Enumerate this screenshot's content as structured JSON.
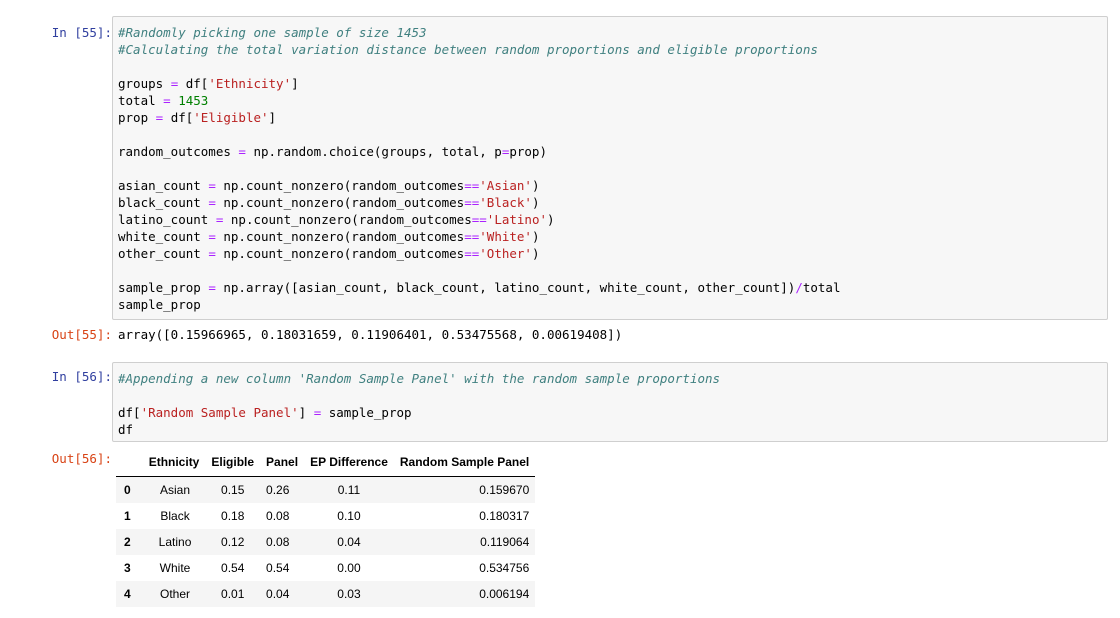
{
  "cell55": {
    "in_prompt": "In [55]:",
    "out_prompt": "Out[55]:",
    "output": "array([0.15966965, 0.18031659, 0.11906401, 0.53475568, 0.00619408])"
  },
  "cell56": {
    "in_prompt": "In [56]:",
    "out_prompt": "Out[56]:",
    "table": {
      "columns": [
        "Ethnicity",
        "Eligible",
        "Panel",
        "EP Difference",
        "Random Sample Panel"
      ],
      "rows": [
        {
          "index": "0",
          "ethnicity": "Asian",
          "eligible": "0.15",
          "panel": "0.26",
          "ep_difference": "0.11",
          "random_sample_panel": "0.159670"
        },
        {
          "index": "1",
          "ethnicity": "Black",
          "eligible": "0.18",
          "panel": "0.08",
          "ep_difference": "0.10",
          "random_sample_panel": "0.180317"
        },
        {
          "index": "2",
          "ethnicity": "Latino",
          "eligible": "0.12",
          "panel": "0.08",
          "ep_difference": "0.04",
          "random_sample_panel": "0.119064"
        },
        {
          "index": "3",
          "ethnicity": "White",
          "eligible": "0.54",
          "panel": "0.54",
          "ep_difference": "0.00",
          "random_sample_panel": "0.534756"
        },
        {
          "index": "4",
          "ethnicity": "Other",
          "eligible": "0.01",
          "panel": "0.04",
          "ep_difference": "0.03",
          "random_sample_panel": "0.006194"
        }
      ]
    }
  },
  "code55": [
    [
      {
        "t": "cm",
        "v": "#Randomly picking one sample of size 1453"
      }
    ],
    [
      {
        "t": "cm",
        "v": "#Calculating the total variation distance between random proportions and eligible proportions"
      }
    ],
    [],
    [
      {
        "t": "",
        "v": "groups "
      },
      {
        "t": "op",
        "v": "="
      },
      {
        "t": "",
        "v": " df["
      },
      {
        "t": "str",
        "v": "'Ethnicity'"
      },
      {
        "t": "",
        "v": "]"
      }
    ],
    [
      {
        "t": "",
        "v": "total "
      },
      {
        "t": "op",
        "v": "="
      },
      {
        "t": "",
        "v": " "
      },
      {
        "t": "num",
        "v": "1453"
      }
    ],
    [
      {
        "t": "",
        "v": "prop "
      },
      {
        "t": "op",
        "v": "="
      },
      {
        "t": "",
        "v": " df["
      },
      {
        "t": "str",
        "v": "'Eligible'"
      },
      {
        "t": "",
        "v": "]"
      }
    ],
    [],
    [
      {
        "t": "",
        "v": "random_outcomes "
      },
      {
        "t": "op",
        "v": "="
      },
      {
        "t": "",
        "v": " np.random.choice(groups, total, p"
      },
      {
        "t": "op",
        "v": "="
      },
      {
        "t": "",
        "v": "prop)"
      }
    ],
    [],
    [
      {
        "t": "",
        "v": "asian_count "
      },
      {
        "t": "op",
        "v": "="
      },
      {
        "t": "",
        "v": " np.count_nonzero(random_outcomes"
      },
      {
        "t": "op",
        "v": "=="
      },
      {
        "t": "str",
        "v": "'Asian'"
      },
      {
        "t": "",
        "v": ")"
      }
    ],
    [
      {
        "t": "",
        "v": "black_count "
      },
      {
        "t": "op",
        "v": "="
      },
      {
        "t": "",
        "v": " np.count_nonzero(random_outcomes"
      },
      {
        "t": "op",
        "v": "=="
      },
      {
        "t": "str",
        "v": "'Black'"
      },
      {
        "t": "",
        "v": ")"
      }
    ],
    [
      {
        "t": "",
        "v": "latino_count "
      },
      {
        "t": "op",
        "v": "="
      },
      {
        "t": "",
        "v": " np.count_nonzero(random_outcomes"
      },
      {
        "t": "op",
        "v": "=="
      },
      {
        "t": "str",
        "v": "'Latino'"
      },
      {
        "t": "",
        "v": ")"
      }
    ],
    [
      {
        "t": "",
        "v": "white_count "
      },
      {
        "t": "op",
        "v": "="
      },
      {
        "t": "",
        "v": " np.count_nonzero(random_outcomes"
      },
      {
        "t": "op",
        "v": "=="
      },
      {
        "t": "str",
        "v": "'White'"
      },
      {
        "t": "",
        "v": ")"
      }
    ],
    [
      {
        "t": "",
        "v": "other_count "
      },
      {
        "t": "op",
        "v": "="
      },
      {
        "t": "",
        "v": " np.count_nonzero(random_outcomes"
      },
      {
        "t": "op",
        "v": "=="
      },
      {
        "t": "str",
        "v": "'Other'"
      },
      {
        "t": "",
        "v": ")"
      }
    ],
    [],
    [
      {
        "t": "",
        "v": "sample_prop "
      },
      {
        "t": "op",
        "v": "="
      },
      {
        "t": "",
        "v": " np.array([asian_count, black_count, latino_count, white_count, other_count])"
      },
      {
        "t": "op",
        "v": "/"
      },
      {
        "t": "",
        "v": "total"
      }
    ],
    [
      {
        "t": "",
        "v": "sample_prop"
      }
    ]
  ],
  "code56": [
    [
      {
        "t": "cm",
        "v": "#Appending a new column 'Random Sample Panel' with the random sample proportions"
      }
    ],
    [],
    [
      {
        "t": "",
        "v": "df["
      },
      {
        "t": "str",
        "v": "'Random Sample Panel'"
      },
      {
        "t": "",
        "v": "] "
      },
      {
        "t": "op",
        "v": "="
      },
      {
        "t": "",
        "v": " sample_prop"
      }
    ],
    [
      {
        "t": "",
        "v": "df"
      }
    ]
  ],
  "colors": {
    "in_prompt": "#303f9f",
    "out_prompt": "#d84315",
    "comment": "#408080",
    "string": "#ba2121",
    "number": "#008000",
    "operator": "#aa22ff",
    "cell_bg": "#f7f7f7"
  }
}
